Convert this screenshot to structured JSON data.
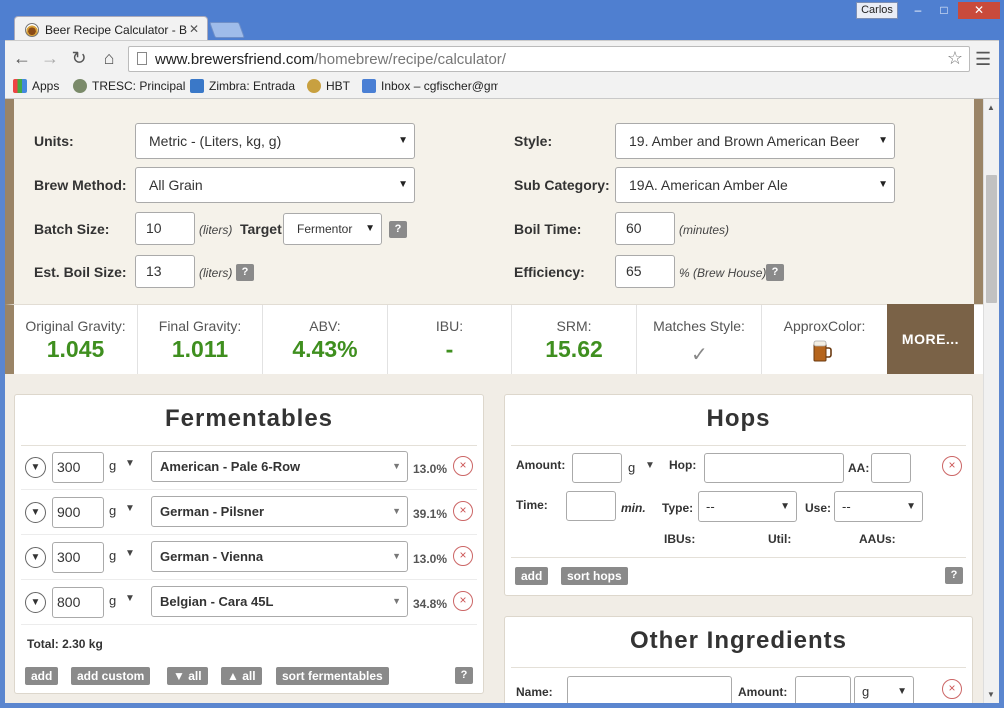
{
  "browser": {
    "tab_title": "Beer Recipe Calculator - B",
    "tab_close": "✕",
    "user": "Carlos",
    "url_host": "www.brewersfriend.com",
    "url_path": "/homebrew/recipe/calculator/",
    "bookmarks": [
      "Apps",
      "TRESC: Principal",
      "Zimbra: Entrada",
      "HBT",
      "Inbox – cgfischer@gm"
    ]
  },
  "settings": {
    "units_label": "Units:",
    "units_value": "Metric - (Liters, kg, g)",
    "brew_method_label": "Brew Method:",
    "brew_method_value": "All Grain",
    "batch_size_label": "Batch Size:",
    "batch_size_value": "10",
    "batch_size_unit": "(liters)",
    "target_label": "Target",
    "target_value": "Fermentor",
    "boil_size_label": "Est. Boil Size:",
    "boil_size_value": "13",
    "boil_size_unit": "(liters)",
    "style_label": "Style:",
    "style_value": "19. Amber and Brown American Beer",
    "sub_category_label": "Sub Category:",
    "sub_category_value": "19A. American Amber Ale",
    "boil_time_label": "Boil Time:",
    "boil_time_value": "60",
    "boil_time_unit": "(minutes)",
    "efficiency_label": "Efficiency:",
    "efficiency_value": "65",
    "efficiency_unit": "% (Brew House)",
    "help": "?"
  },
  "stats": {
    "og_label": "Original Gravity:",
    "og_value": "1.045",
    "fg_label": "Final Gravity:",
    "fg_value": "1.011",
    "abv_label": "ABV:",
    "abv_value": "4.43%",
    "ibu_label": "IBU:",
    "ibu_value": "-",
    "srm_label": "SRM:",
    "srm_value": "15.62",
    "matches_label": "Matches Style:",
    "color_label": "ApproxColor:",
    "more_label": "MORE..."
  },
  "fermentables": {
    "title": "Fermentables",
    "rows": [
      {
        "amount": "300",
        "unit": "g",
        "name": "American - Pale 6-Row",
        "pct": "13.0%"
      },
      {
        "amount": "900",
        "unit": "g",
        "name": "German - Pilsner",
        "pct": "39.1%"
      },
      {
        "amount": "300",
        "unit": "g",
        "name": "German - Vienna",
        "pct": "13.0%"
      },
      {
        "amount": "800",
        "unit": "g",
        "name": "Belgian - Cara 45L",
        "pct": "34.8%"
      }
    ],
    "total": "Total: 2.30 kg",
    "buttons": {
      "add": "add",
      "add_custom": "add custom",
      "collapse_all": "▼ all",
      "expand_all": "▲ all",
      "sort": "sort fermentables"
    }
  },
  "hops": {
    "title": "Hops",
    "amount_label": "Amount:",
    "unit": "g",
    "hop_label": "Hop:",
    "aa_label": "AA:",
    "time_label": "Time:",
    "min_label": "min.",
    "type_label": "Type:",
    "type_value": "--",
    "use_label": "Use:",
    "use_value": "--",
    "ibus_label": "IBUs:",
    "util_label": "Util:",
    "aaus_label": "AAUs:",
    "buttons": {
      "add": "add",
      "sort": "sort hops"
    }
  },
  "other": {
    "title": "Other Ingredients",
    "name_label": "Name:",
    "amount_label": "Amount:",
    "unit": "g"
  }
}
